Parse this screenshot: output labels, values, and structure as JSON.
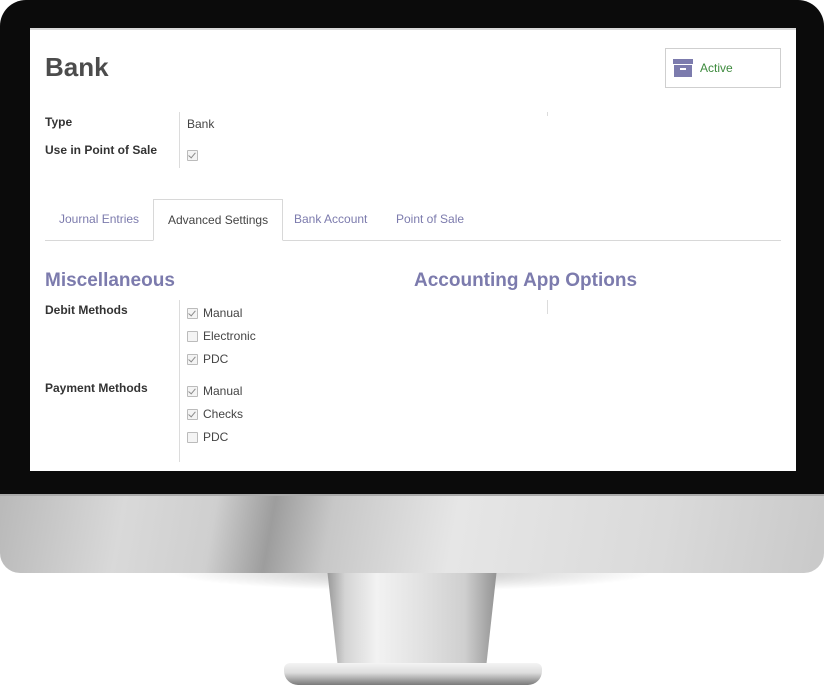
{
  "record": {
    "title": "Bank",
    "status_label": "Active"
  },
  "fields": {
    "type_label": "Type",
    "type_value": "Bank",
    "pos_label": "Use in Point of Sale",
    "pos_checked": true
  },
  "tabs": [
    {
      "label": "Journal Entries",
      "active": false
    },
    {
      "label": "Advanced Settings",
      "active": true
    },
    {
      "label": "Bank Account",
      "active": false
    },
    {
      "label": "Point of Sale",
      "active": false
    }
  ],
  "sections": {
    "misc_title": "Miscellaneous",
    "accounting_title": "Accounting App Options"
  },
  "debit_methods": {
    "label": "Debit Methods",
    "options": [
      {
        "label": "Manual",
        "checked": true
      },
      {
        "label": "Electronic",
        "checked": false
      },
      {
        "label": "PDC",
        "checked": true
      }
    ]
  },
  "payment_methods": {
    "label": "Payment Methods",
    "options": [
      {
        "label": "Manual",
        "checked": true
      },
      {
        "label": "Checks",
        "checked": true
      },
      {
        "label": "PDC",
        "checked": false
      }
    ]
  },
  "colors": {
    "accent": "#7c7bad",
    "active_status": "#3d8a3d"
  },
  "icons": {
    "status": "archive-icon"
  }
}
